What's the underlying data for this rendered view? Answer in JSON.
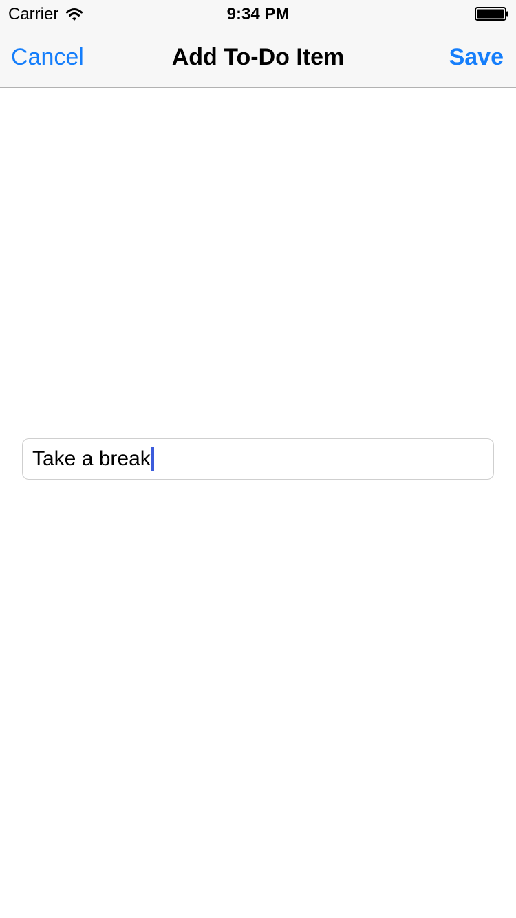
{
  "status_bar": {
    "carrier": "Carrier",
    "time": "9:34 PM",
    "icons": [
      "wifi-icon",
      "battery-icon"
    ]
  },
  "nav_bar": {
    "left_button": "Cancel",
    "title": "Add To-Do Item",
    "right_button": "Save",
    "accent_color": "#157efb"
  },
  "form": {
    "item_field": {
      "value": "Take a break",
      "focused": true
    }
  }
}
